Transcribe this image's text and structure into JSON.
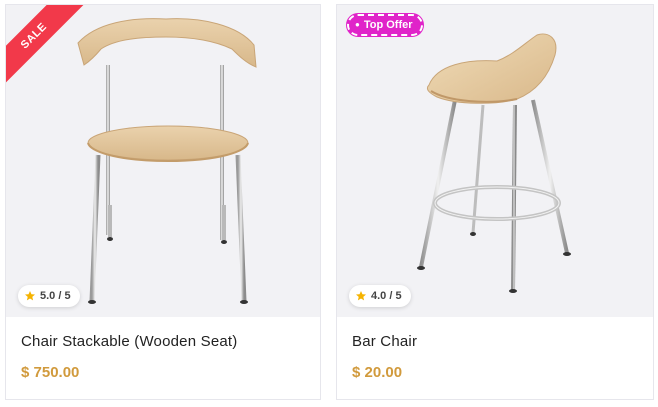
{
  "products": [
    {
      "name": "Chair Stackable (Wooden Seat)",
      "price": "$ 750.00",
      "rating": "5.0 / 5",
      "badge": "SALE",
      "image": "wooden-stackable-chair"
    },
    {
      "name": "Bar Chair",
      "price": "$ 20.00",
      "rating": "4.0 / 5",
      "badge": "Top Offer",
      "image": "wooden-bar-stool"
    }
  ],
  "colors": {
    "price": "#d19a3c",
    "sale_ribbon": "#f2394a",
    "offer_badge": "#e024c9",
    "star": "#f5b301",
    "image_bg": "#f2f2f5"
  },
  "icons": {
    "rating": "star-icon",
    "offer": "dot-icon"
  }
}
